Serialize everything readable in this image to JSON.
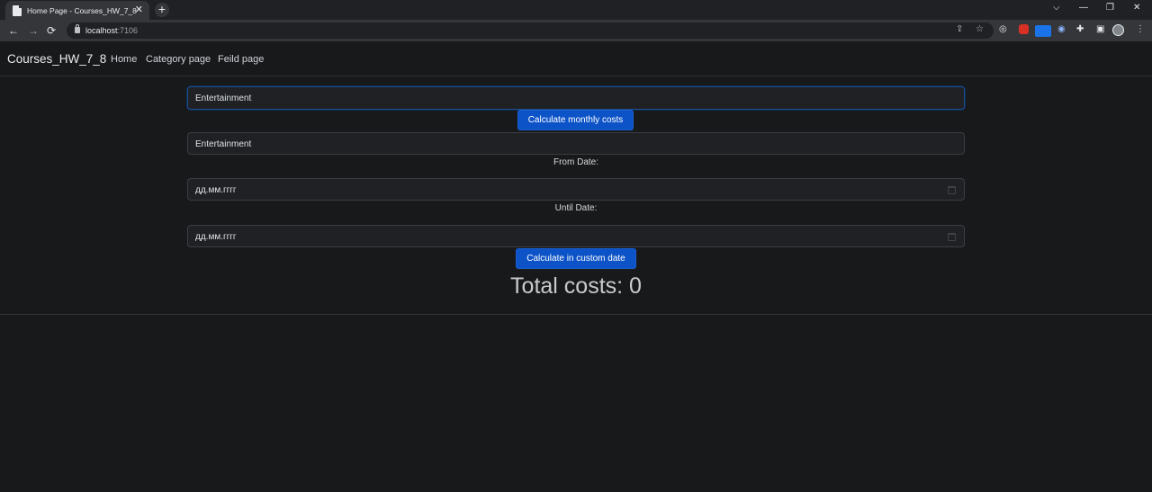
{
  "browser": {
    "tab_title": "Home Page - Courses_HW_7_8",
    "tab_close": "✕",
    "new_tab": "+",
    "url_host": "localhost",
    "url_port": ":7106",
    "controls": {
      "chevron": "⌵",
      "minimize": "—",
      "restore": "❐",
      "close": "✕"
    },
    "nav": {
      "back": "←",
      "forward": "→",
      "reload": "⟳"
    }
  },
  "navbar": {
    "brand": "Courses_HW_7_8",
    "links": [
      "Home",
      "Category page",
      "Feild page"
    ]
  },
  "form": {
    "category_monthly_value": "Entertainment",
    "monthly_button": "Calculate monthly costs",
    "category_custom_value": "Entertainment",
    "from_label": "From Date:",
    "from_placeholder": "дд.мм.гггг",
    "until_label": "Until Date:",
    "until_placeholder": "дд.мм.гггг",
    "custom_button": "Calculate in custom date"
  },
  "result": {
    "total_text": "Total costs: 0"
  },
  "colors": {
    "page_bg": "#18191b",
    "button_primary": "#0d53c8",
    "input_bg": "#1f2124"
  }
}
